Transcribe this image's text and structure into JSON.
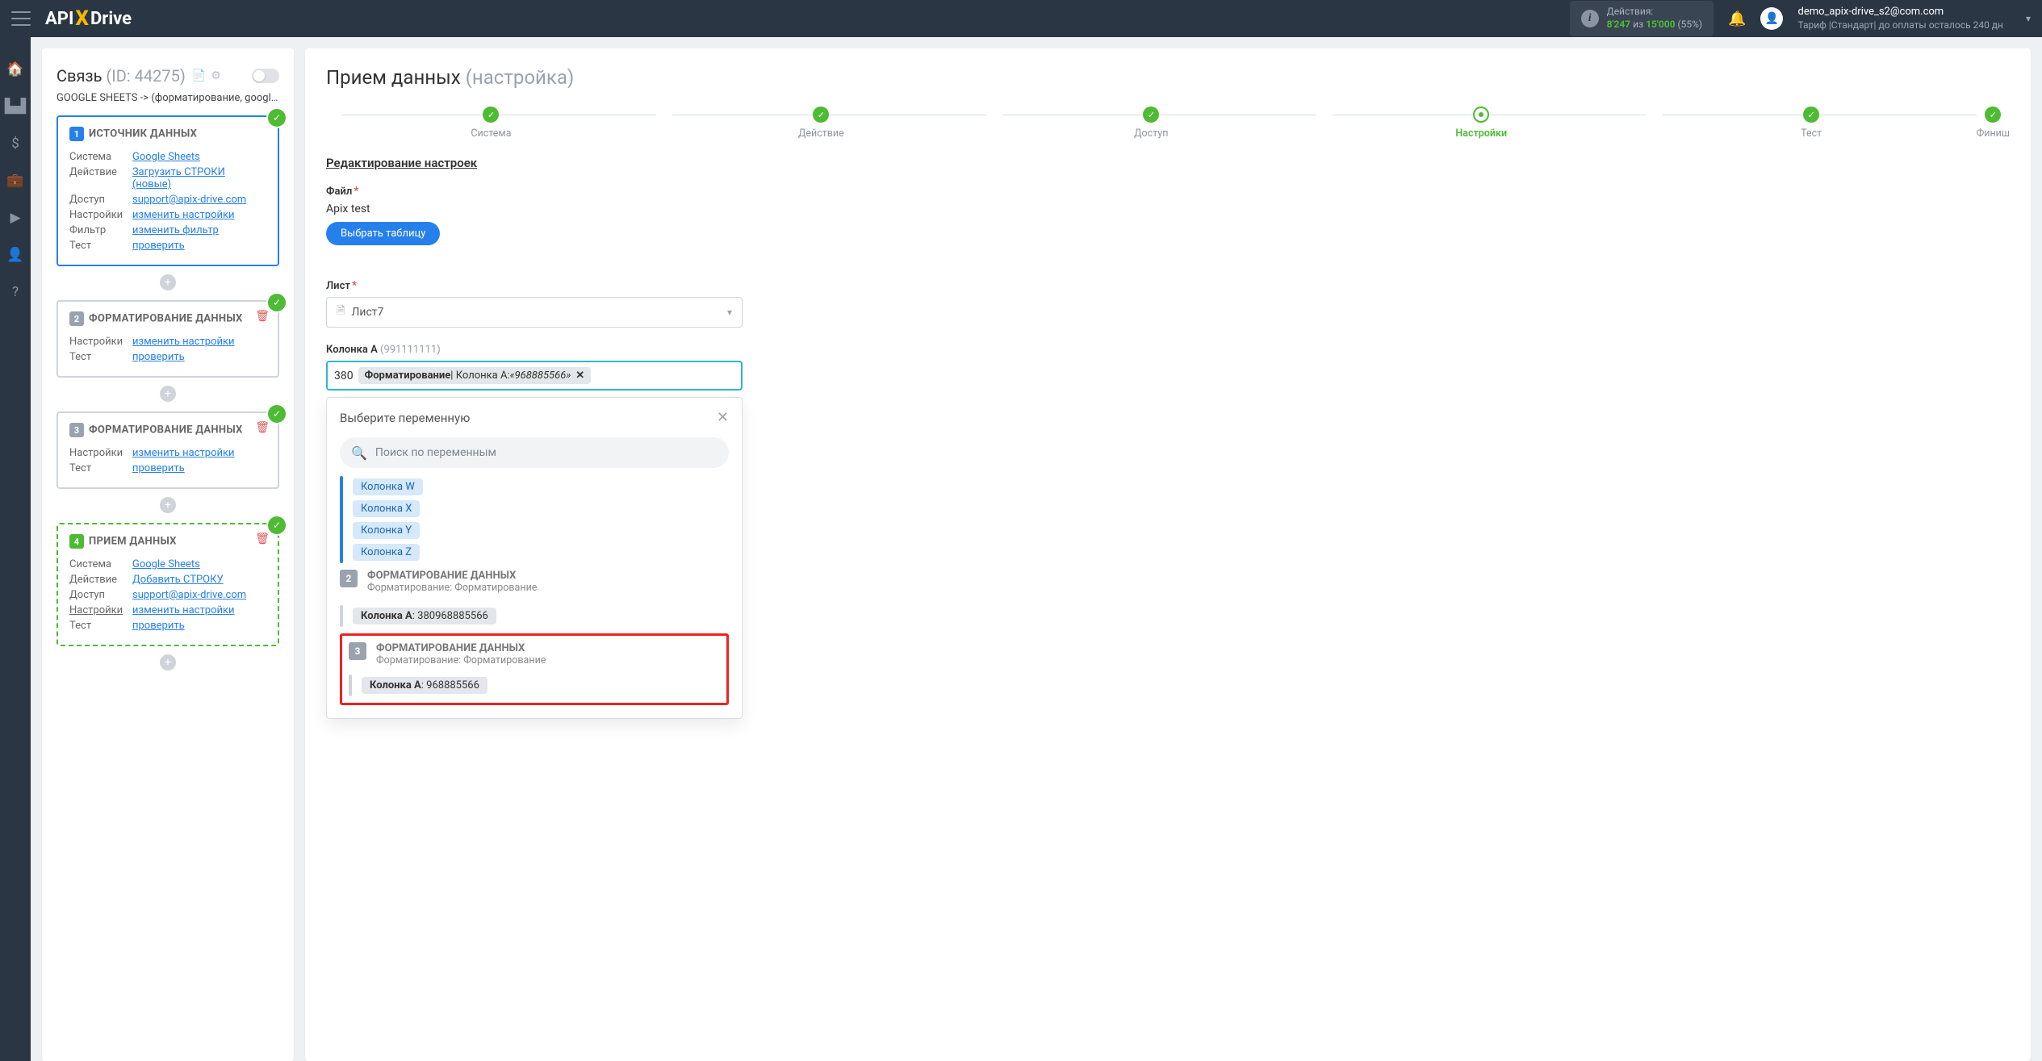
{
  "topbar": {
    "logo_1": "API",
    "logo_x": "X",
    "logo_2": "Drive",
    "actions_label": "Действия:",
    "actions_used": "8'247",
    "actions_sep": "из",
    "actions_total": "15'000",
    "actions_pct": "(55%)",
    "user_email": "demo_apix-drive_s2@com.com",
    "tariff": "Тариф |Стандарт| до оплаты осталось 240 дн"
  },
  "panel": {
    "title": "Связь",
    "id": "(ID: 44275)",
    "subtitle": "GOOGLE SHEETS -> (форматирование, google s",
    "card1": {
      "num": "1",
      "title": "ИСТОЧНИК ДАННЫХ",
      "rows": [
        [
          "Система",
          "Google Sheets"
        ],
        [
          "Действие",
          "Загрузить СТРОКИ (новые)"
        ],
        [
          "Доступ",
          "support@apix-drive.com"
        ],
        [
          "Настройки",
          "изменить настройки"
        ],
        [
          "Фильтр",
          "изменить фильтр"
        ],
        [
          "Тест",
          "проверить"
        ]
      ]
    },
    "card2": {
      "num": "2",
      "title": "ФОРМАТИРОВАНИЕ ДАННЫХ",
      "rows": [
        [
          "Настройки",
          "изменить настройки"
        ],
        [
          "Тест",
          "проверить"
        ]
      ]
    },
    "card3": {
      "num": "3",
      "title": "ФОРМАТИРОВАНИЕ ДАННЫХ",
      "rows": [
        [
          "Настройки",
          "изменить настройки"
        ],
        [
          "Тест",
          "проверить"
        ]
      ]
    },
    "card4": {
      "num": "4",
      "title": "ПРИЕМ ДАННЫХ",
      "rows": [
        [
          "Система",
          "Google Sheets"
        ],
        [
          "Действие",
          "Добавить СТРОКУ"
        ],
        [
          "Доступ",
          "support@apix-drive.com"
        ],
        [
          "Настройки",
          "изменить настройки"
        ],
        [
          "Тест",
          "проверить"
        ]
      ]
    }
  },
  "content": {
    "title": "Прием данных",
    "title_sub": "(настройка)",
    "steps": [
      "Система",
      "Действие",
      "Доступ",
      "Настройки",
      "Тест",
      "Финиш"
    ],
    "section": "Редактирование настроек",
    "file_label": "Файл",
    "file": "Apix test",
    "choose": "Выбрать таблицу",
    "sheet_label": "Лист",
    "sheet": "Лист7",
    "col_label": "Колонка A",
    "col_hint": "(991111111)",
    "chip_pre": "380",
    "chip_b": "Форматирование",
    "chip_mid": " | Колонка A: ",
    "chip_it": "«968885566»",
    "pop_title": "Выберите переменную",
    "pop_search": "Поиск по переменным",
    "cols": [
      "Колонка W",
      "Колонка X",
      "Колонка Y",
      "Колонка Z"
    ],
    "g2": {
      "num": "2",
      "t": "ФОРМАТИРОВАНИЕ ДАННЫХ",
      "s": "Форматирование: Форматирование",
      "tag_b": "Колонка A",
      "tag_v": ": 380968885566"
    },
    "g3": {
      "num": "3",
      "t": "ФОРМАТИРОВАНИЕ ДАННЫХ",
      "s": "Форматирование: Форматирование",
      "tag_b": "Колонка A",
      "tag_v": ": 968885566"
    }
  }
}
